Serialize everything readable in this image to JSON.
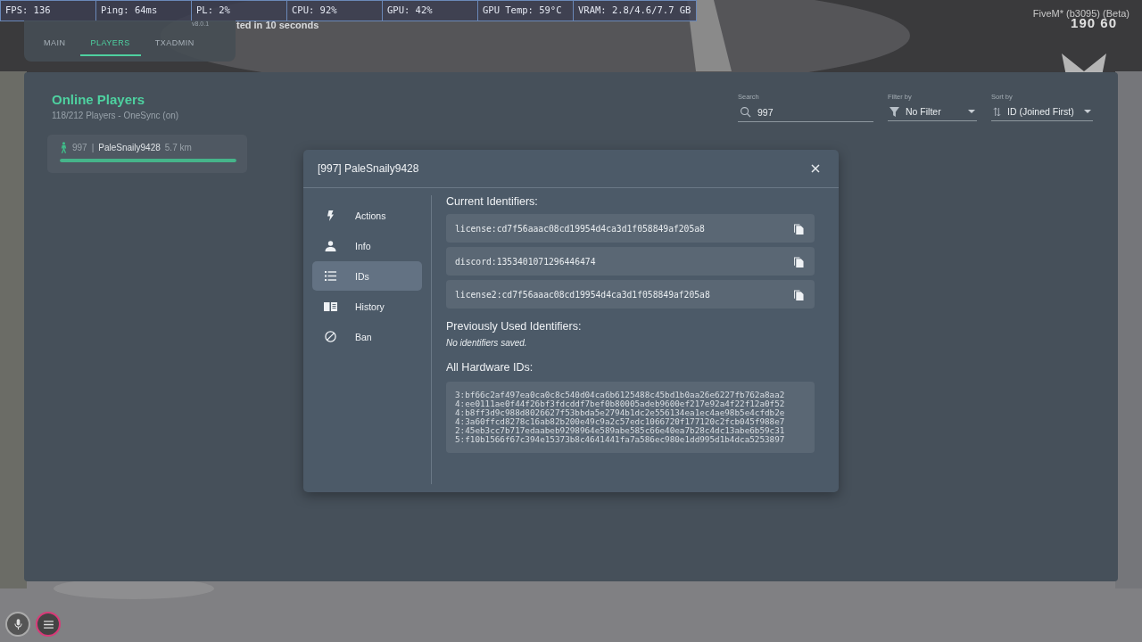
{
  "stats_bar": [
    "FPS: 136",
    "Ping: 64ms",
    "PL: 2%",
    "CPU: 92%",
    "GPU: 42%",
    "GPU Temp: 59°C",
    "VRAM: 2.8/4.6/7.7 GB"
  ],
  "txadmin_menu": {
    "version": "v8.0.1",
    "tabs": [
      {
        "label": "MAIN",
        "selected": false
      },
      {
        "label": "PLAYERS",
        "selected": true
      },
      {
        "label": "TXADMIN",
        "selected": false
      }
    ]
  },
  "notice": "ted in 10 seconds",
  "game_hud": {
    "build": "FiveM* (b3095) (Beta)",
    "counter": "190 60"
  },
  "players_panel": {
    "title": "Online Players",
    "subtitle": "118/212 Players - OneSync (on)",
    "search": {
      "label": "Search",
      "value": "997"
    },
    "filter": {
      "label": "Filter by",
      "value": "No Filter"
    },
    "sort": {
      "label": "Sort by",
      "value": "ID (Joined First)"
    },
    "players": [
      {
        "id": "997",
        "separator": "|",
        "name": "PaleSnaily9428",
        "distance": "5.7 km",
        "level": 1.0
      }
    ]
  },
  "modal": {
    "title": "[997] PaleSnaily9428",
    "menu": [
      {
        "label": "Actions",
        "kind": "actions",
        "selected": false
      },
      {
        "label": "Info",
        "kind": "info",
        "selected": false
      },
      {
        "label": "IDs",
        "kind": "ids",
        "selected": true
      },
      {
        "label": "History",
        "kind": "history",
        "selected": false
      },
      {
        "label": "Ban",
        "kind": "ban",
        "selected": false
      }
    ],
    "current_title": "Current Identifiers:",
    "identifiers": [
      "license:cd7f56aaac08cd19954d4ca3d1f058849af205a8",
      "discord:1353401071296446474",
      "license2:cd7f56aaac08cd19954d4ca3d1f058849af205a8"
    ],
    "previous_title": "Previously Used Identifiers:",
    "previous_empty": "No identifiers saved.",
    "hwid_title": "All Hardware IDs:",
    "hwids": [
      "3:bf66c2af497ea0ca0c8c540d04ca6b6125488c45bd1b0aa26e6227fb762a8aa2",
      "4:ee0111ae0f44f26bf3fdcddf7bef0b80005adeb9600ef217e92a4f22f12a0f52",
      "4:b8ff3d9c988d8026627f53bbda5e2794b1dc2e556134ea1ec4ae98b5e4cfdb2e",
      "4:3a60ffcd8278c16ab82b200e49c9a2c57edc1066720f177120c2fcb045f988e7",
      "2:45eb3cc7b717edaabeb9298964e589abe585c66e40ea7b28c4dc13abe6b59c31",
      "5:f10b1566f67c394e15373b8c4641441fa7a586ec980e1dd995d1b4dca5253897"
    ]
  }
}
